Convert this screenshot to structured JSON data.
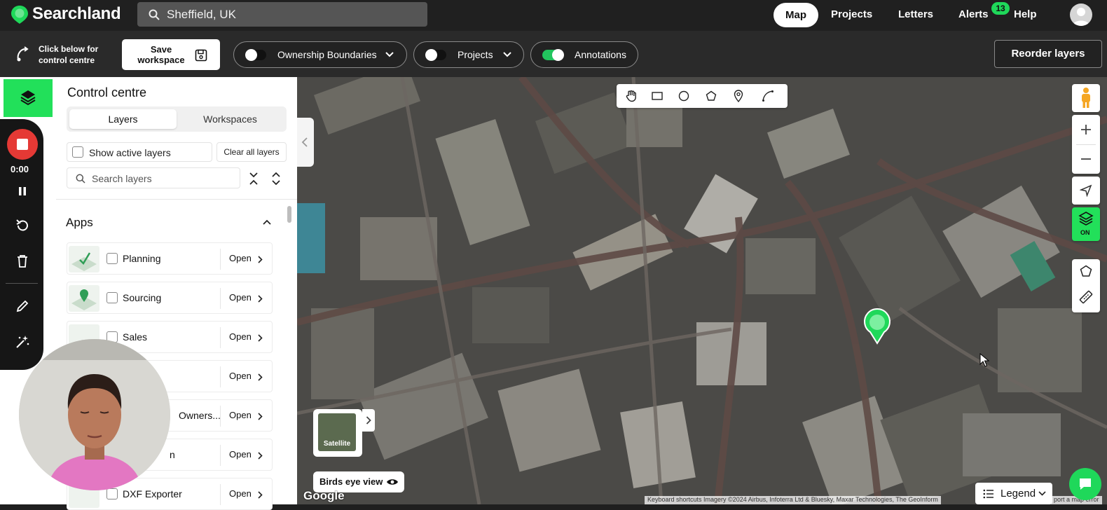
{
  "app": {
    "brand": "Searchland",
    "brand_color": "#1fd85a"
  },
  "search": {
    "value": "Sheffield, UK"
  },
  "nav": {
    "map": "Map",
    "projects": "Projects",
    "letters": "Letters",
    "alerts": "Alerts",
    "alerts_count": "13",
    "help": "Help"
  },
  "toolbar": {
    "control_hint": "Click below for control centre",
    "save_workspace": "Save workspace",
    "ownership_boundaries": {
      "label": "Ownership Boundaries",
      "on": false
    },
    "projects": {
      "label": "Projects",
      "on": false
    },
    "annotations": {
      "label": "Annotations",
      "on": true
    },
    "reorder_layers": "Reorder layers"
  },
  "recorder": {
    "time": "0:00"
  },
  "panel": {
    "title": "Control centre",
    "tabs": [
      "Layers",
      "Workspaces"
    ],
    "active_tab": "Layers",
    "show_active_layers": "Show active layers",
    "clear_all_layers": "Clear all layers",
    "search_placeholder": "Search layers",
    "section": "Apps",
    "apps": [
      {
        "name": "Planning",
        "action": "Open"
      },
      {
        "name": "Sourcing",
        "action": "Open"
      },
      {
        "name": "Sales",
        "action": "Open"
      },
      {
        "name": "",
        "action": "Open"
      },
      {
        "name": "Owners...",
        "action": "Open"
      },
      {
        "name": "n",
        "action": "Open"
      },
      {
        "name": "DXF Exporter",
        "action": "Open"
      }
    ]
  },
  "map": {
    "basemap_label": "Satellite",
    "birds_eye": "Birds eye view",
    "google": "Google",
    "attribution": "Keyboard shortcuts     Imagery ©2024 Airbus, Infoterra Ltd & Bluesky, Maxar Technologies, The GeoInform",
    "attribution_end": "port a map error",
    "legend": "Legend",
    "layers_toggle": "ON"
  }
}
